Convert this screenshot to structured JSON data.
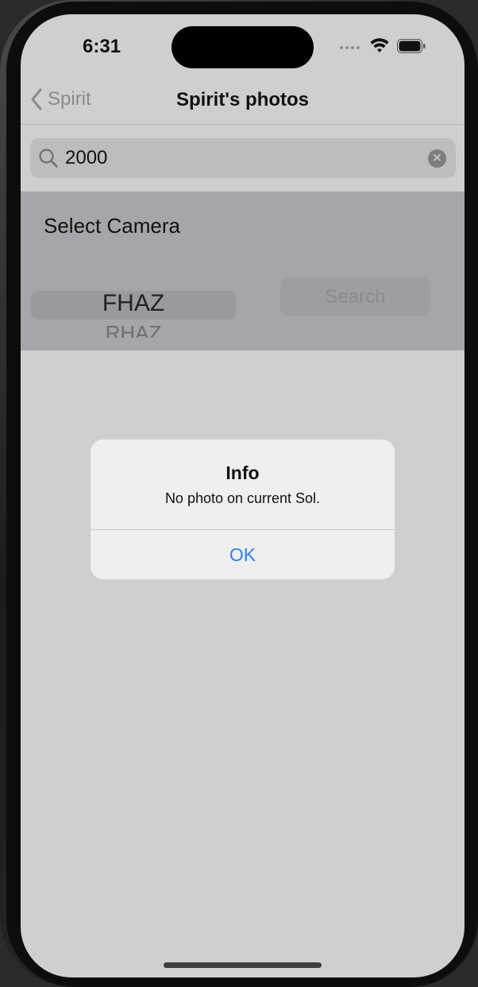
{
  "status_bar": {
    "time": "6:31"
  },
  "nav": {
    "back_label": "Spirit",
    "title": "Spirit's photos"
  },
  "search": {
    "value": "2000"
  },
  "camera_panel": {
    "label": "Select Camera",
    "picker_options": [
      "FHAZ",
      "RHAZ"
    ],
    "selected": "FHAZ",
    "search_button_label": "Search"
  },
  "alert": {
    "title": "Info",
    "message": "No photo on current Sol.",
    "ok_label": "OK"
  },
  "colors": {
    "accent": "#2f7ff3",
    "screen_background": "#cfcfcf",
    "panel_background": "#a6a6aa"
  }
}
